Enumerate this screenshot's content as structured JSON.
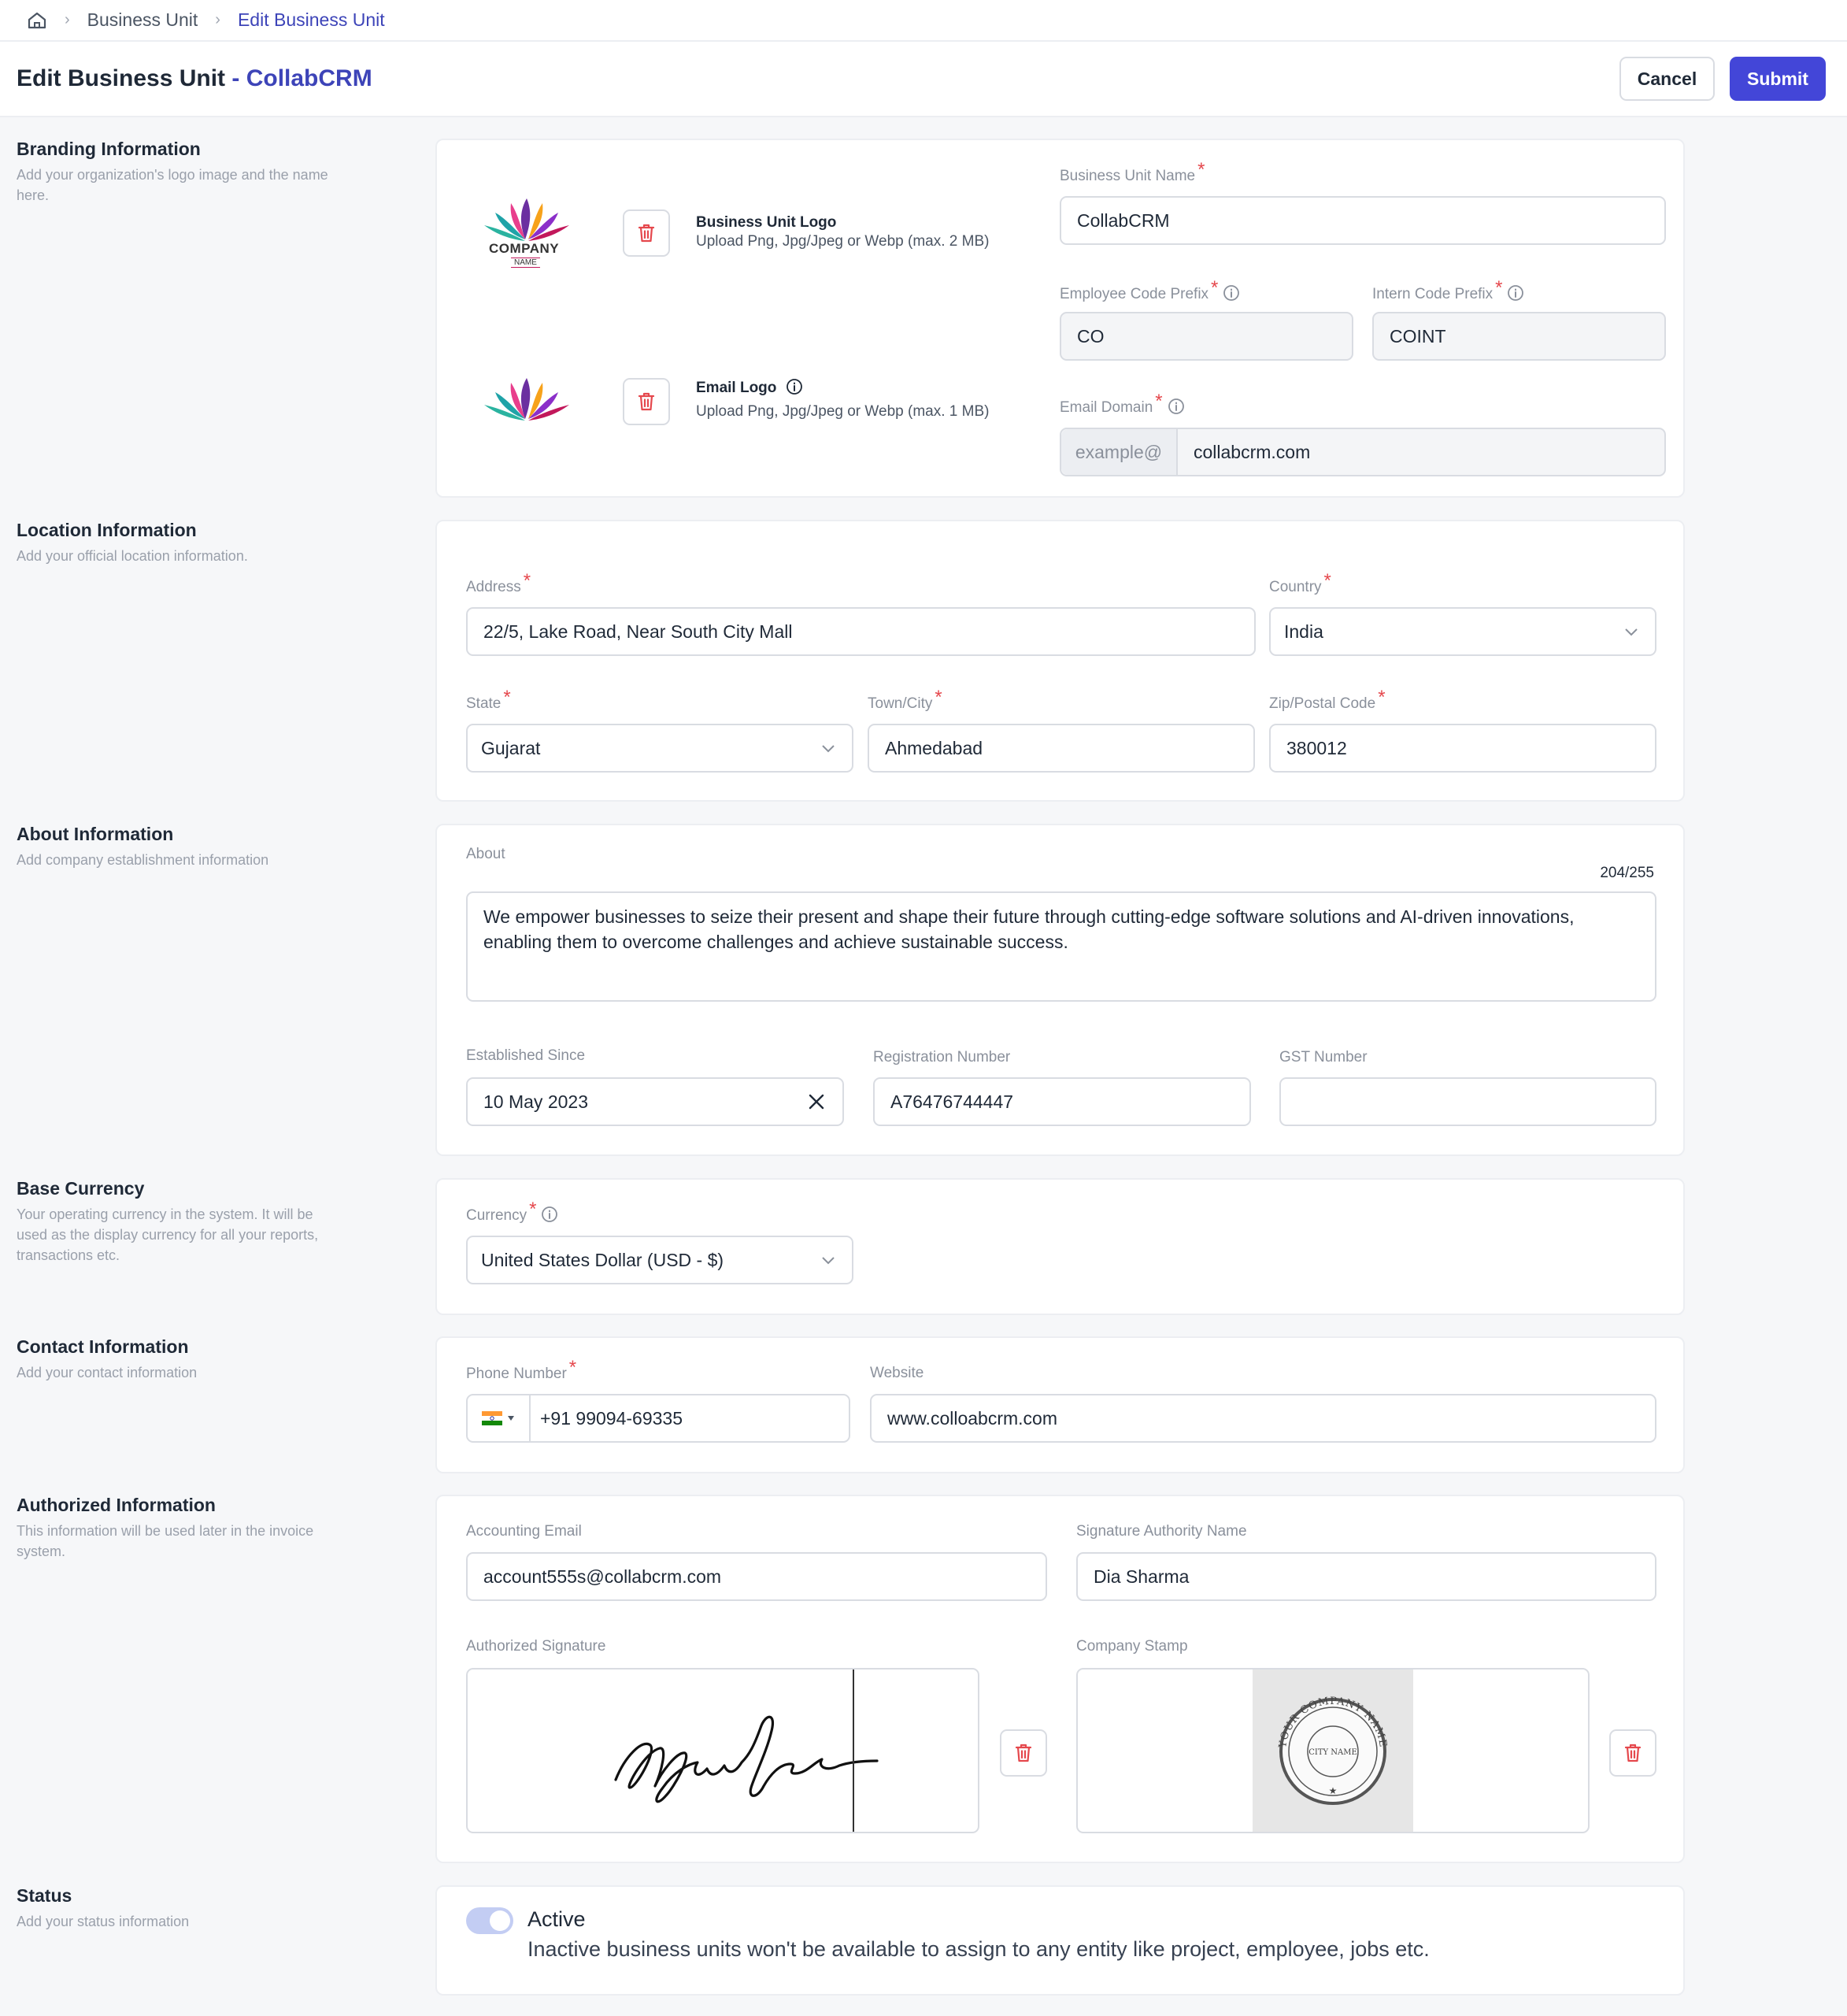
{
  "breadcrumb": {
    "items": [
      "Business Unit",
      "Edit Business Unit"
    ]
  },
  "header": {
    "title": "Edit Business Unit",
    "title_accent": "- CollabCRM",
    "cancel_label": "Cancel",
    "submit_label": "Submit"
  },
  "sections": {
    "branding": {
      "title": "Branding Information",
      "desc": "Add your organization's logo image and the name here."
    },
    "location": {
      "title": "Location Information",
      "desc": "Add your official location information."
    },
    "about": {
      "title": "About Information",
      "desc": "Add company establishment information"
    },
    "currency": {
      "title": "Base Currency",
      "desc": "Your operating currency in the system. It will be used as the display currency for all your reports, transactions etc."
    },
    "contact": {
      "title": "Contact Information",
      "desc": "Add your contact information"
    },
    "authorized": {
      "title": "Authorized Information",
      "desc": "This information will be used later in the invoice system."
    },
    "status": {
      "title": "Status",
      "desc": "Add your status information"
    }
  },
  "branding": {
    "logo_company_text": "COMPANY",
    "logo_name_text": "NAME",
    "bu_logo_title": "Business Unit Logo",
    "bu_logo_hint": "Upload Png, Jpg/Jpeg or Webp (max. 2 MB)",
    "email_logo_title": "Email Logo",
    "email_logo_hint": "Upload Png, Jpg/Jpeg or Webp (max. 1 MB)",
    "bu_name_label": "Business Unit Name",
    "bu_name_value": "CollabCRM",
    "emp_prefix_label": "Employee Code Prefix",
    "emp_prefix_value": "CO",
    "intern_prefix_label": "Intern Code Prefix",
    "intern_prefix_value": "COINT",
    "email_domain_label": "Email Domain",
    "email_domain_addon": "example@",
    "email_domain_value": "collabcrm.com"
  },
  "location": {
    "address_label": "Address",
    "address_value": "22/5, Lake Road, Near South City Mall",
    "country_label": "Country",
    "country_value": "India",
    "state_label": "State",
    "state_value": "Gujarat",
    "city_label": "Town/City",
    "city_value": "Ahmedabad",
    "zip_label": "Zip/Postal Code",
    "zip_value": "380012"
  },
  "about": {
    "about_label": "About",
    "char_count": "204/255",
    "about_value": "We empower businesses to seize their present and shape their future through cutting-edge software solutions and AI-driven innovations, enabling them to overcome challenges and achieve sustainable success.",
    "established_label": "Established Since",
    "established_value": "10 May 2023",
    "registration_label": "Registration Number",
    "registration_value": "A76476744447",
    "gst_label": "GST Number",
    "gst_value": ""
  },
  "currency": {
    "currency_label": "Currency",
    "currency_value": "United States Dollar (USD - $)"
  },
  "contact": {
    "phone_label": "Phone Number",
    "phone_value": "+91 99094-69335",
    "website_label": "Website",
    "website_value": "www.colloabcrm.com"
  },
  "authorized": {
    "accounting_email_label": "Accounting Email",
    "accounting_email_value": "account555s@collabcrm.com",
    "signatory_label": "Signature Authority Name",
    "signatory_value": "Dia Sharma",
    "signature_label": "Authorized Signature",
    "stamp_label": "Company Stamp",
    "stamp_top_text": "YOUR COMPANY NAME",
    "stamp_center_text": "CITY NAME"
  },
  "status": {
    "label": "Active",
    "desc": "Inactive business units won't be available to assign to any entity like project, employee, jobs etc.",
    "active": true
  },
  "colors": {
    "accent": "#4346d8",
    "accent_text": "#3d44b8",
    "required": "#e5484d",
    "trash": "#e5484d"
  }
}
